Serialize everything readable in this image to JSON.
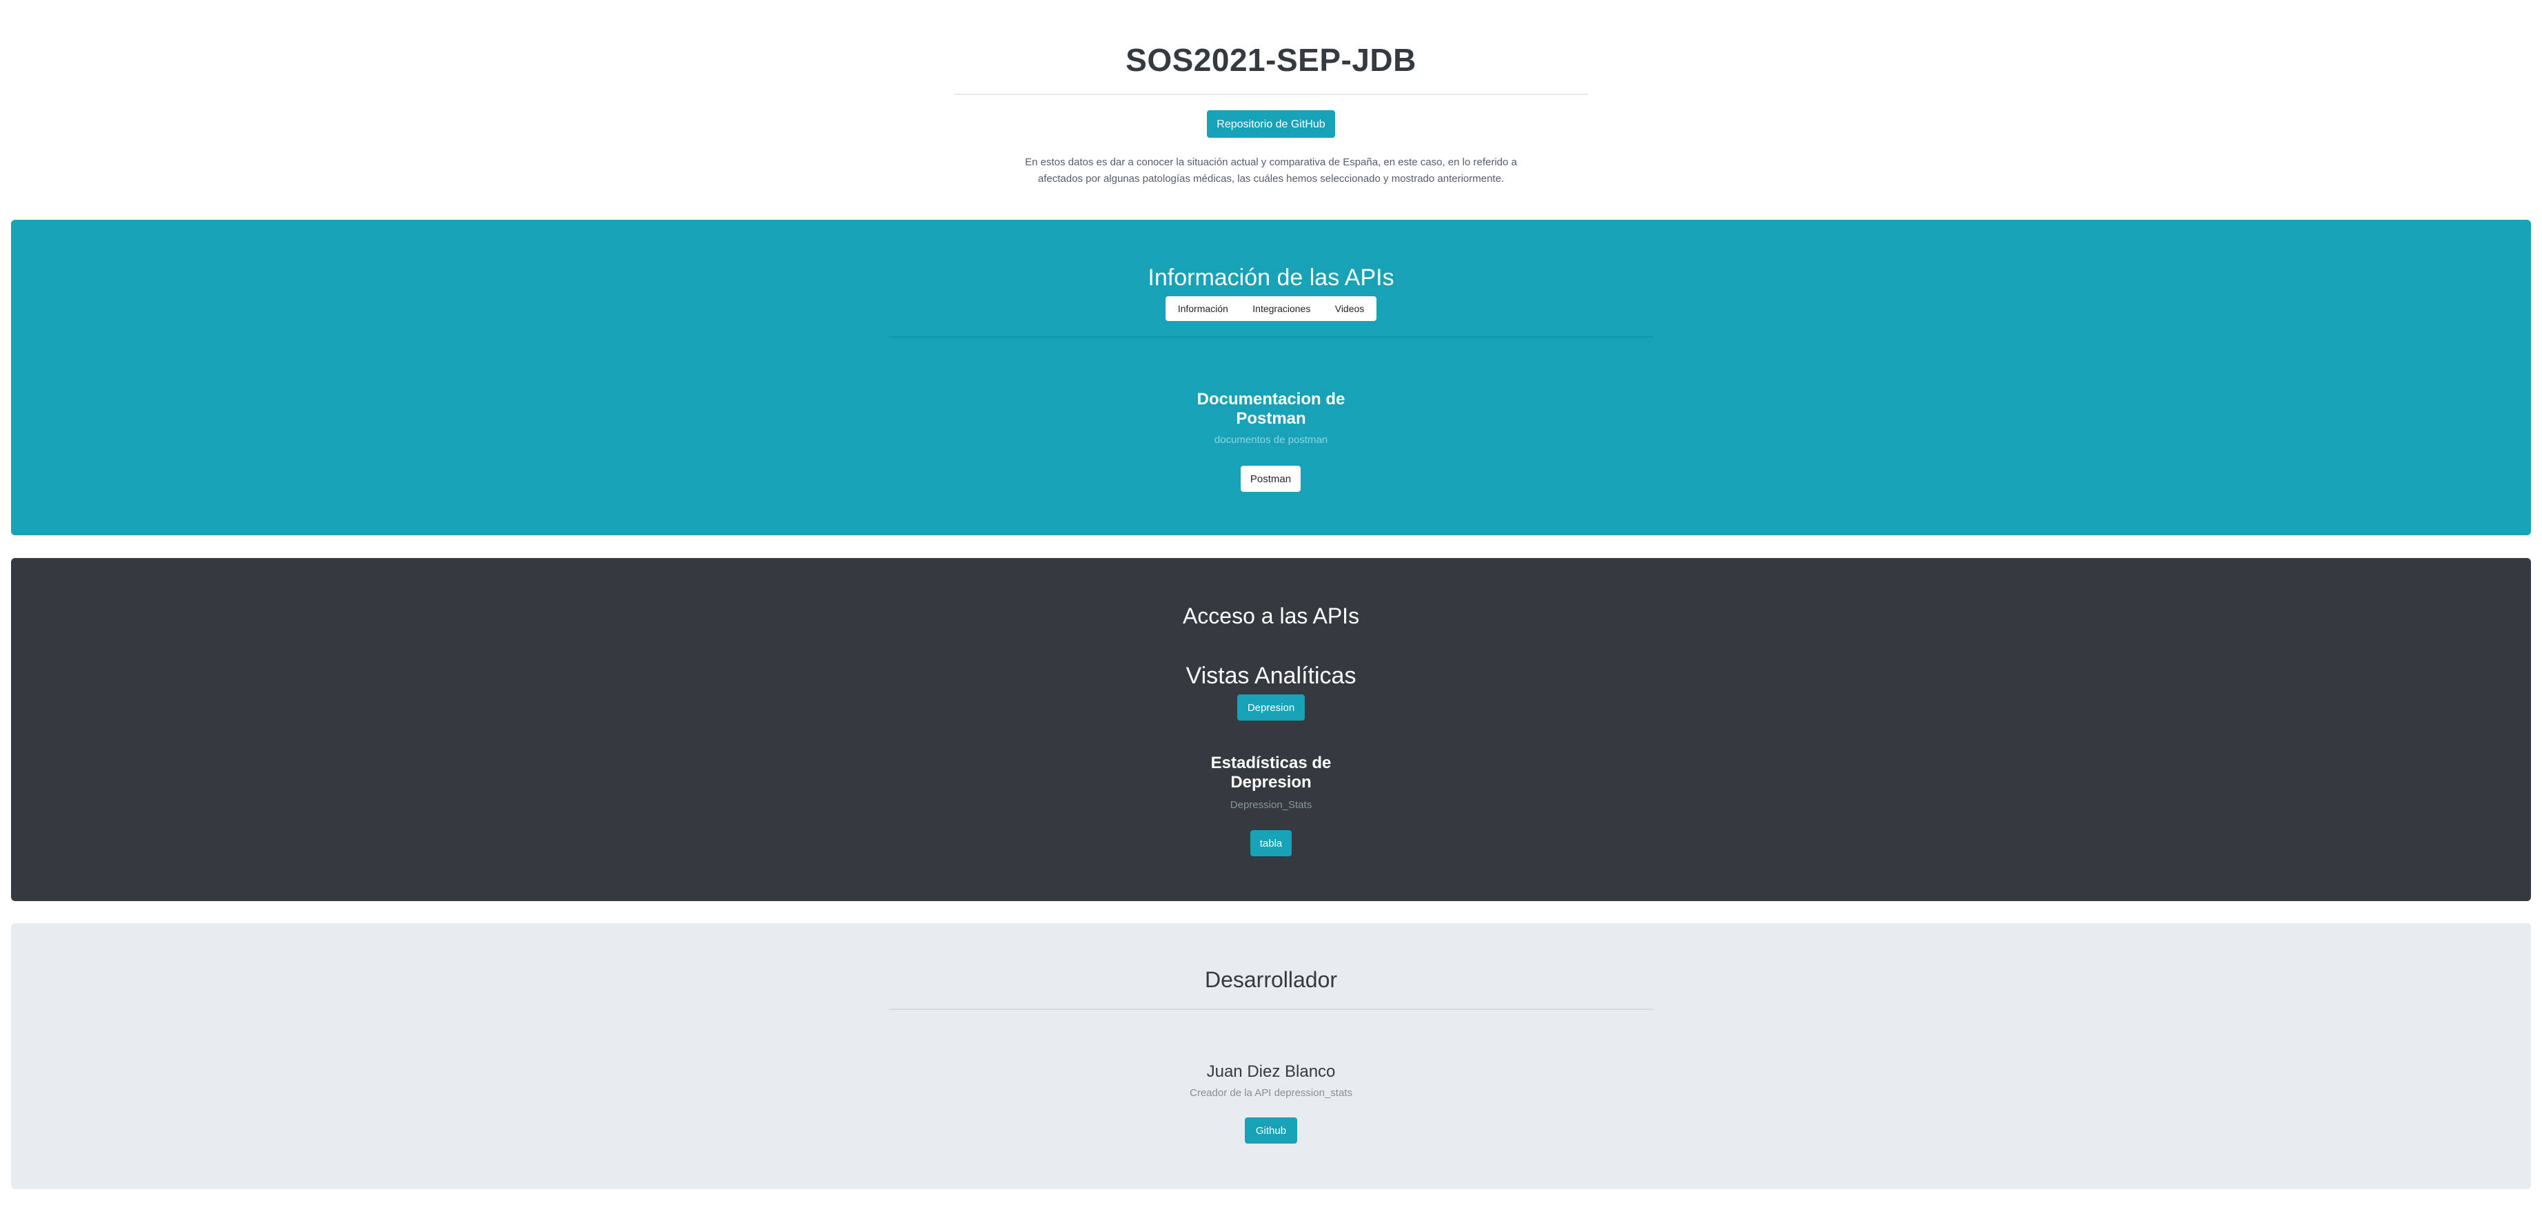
{
  "header": {
    "title": "SOS2021-SEP-JDB",
    "github_button": "Repositorio de GitHub",
    "intro_line1": "En estos datos es dar a conocer la situación actual y comparativa de España, en este caso, en lo referido a",
    "intro_line2": "afectados por algunas patologías médicas, las cuáles hemos seleccionado y mostrado anteriormente."
  },
  "info_panel": {
    "heading": "Información de las APIs",
    "tabs": [
      "Información",
      "Integraciones",
      "Videos"
    ],
    "card": {
      "title_line1": "Documentacion de",
      "title_line2": "Postman",
      "subtitle": "documentos de postman",
      "button": "Postman"
    }
  },
  "access_panel": {
    "heading": "Acceso a las APIs",
    "analytics_heading": "Vistas Analíticas",
    "analytics_button": "Depresion",
    "card": {
      "title_line1": "Estadísticas de",
      "title_line2": "Depresion",
      "subtitle": "Depression_Stats",
      "button": "tabla"
    }
  },
  "developer_panel": {
    "heading": "Desarrollador",
    "name": "Juan Diez Blanco",
    "role": "Creador de la API depression_stats",
    "button": "Github"
  },
  "colors": {
    "info": "#17a2b8",
    "dark": "#343a40",
    "light": "#e9ecef"
  }
}
